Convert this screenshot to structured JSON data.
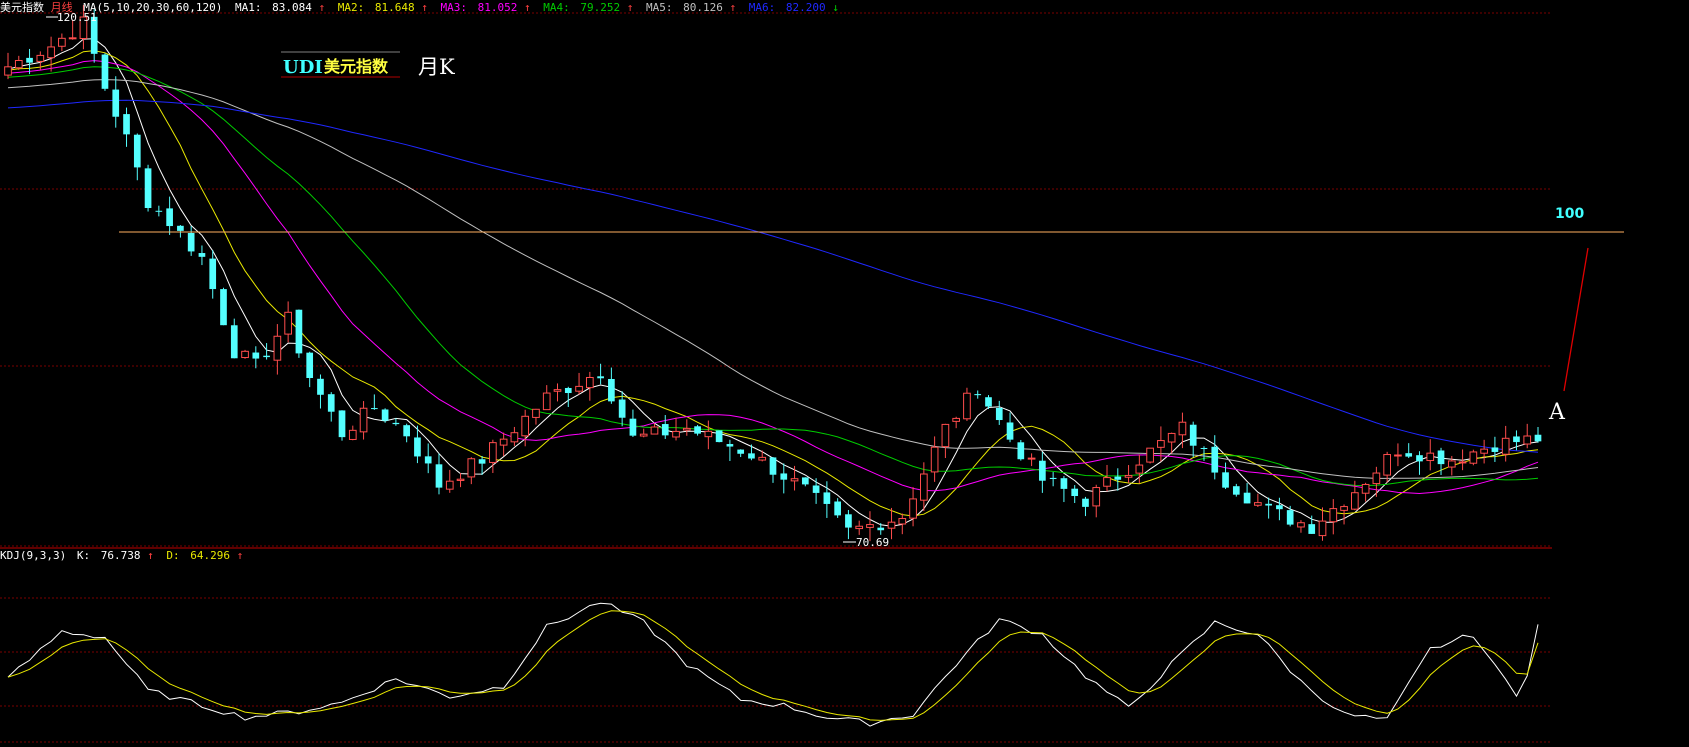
{
  "colors": {
    "up": "#ff4d4d",
    "down": "#54ffff",
    "ma1": "#ffffff",
    "ma2": "#e8e800",
    "ma3": "#ff00ff",
    "ma4": "#00cc00",
    "ma5": "#c0c0c0",
    "ma6": "#1f28ff",
    "grid": "#7a0000",
    "kline": "#ffffff",
    "dline": "#e8e800",
    "hundred": "#ffb060",
    "arrow": "#e00000"
  },
  "header": {
    "name": "美元指数",
    "period": "月线",
    "ma_params": "MA(5,10,20,30,60,120)",
    "ma": [
      {
        "label": "MA1:",
        "value": "83.084",
        "arrow": "↑",
        "color": "#ffffff"
      },
      {
        "label": "MA2:",
        "value": "81.648",
        "arrow": "↑",
        "color": "#e8e800"
      },
      {
        "label": "MA3:",
        "value": "81.052",
        "arrow": "↑",
        "color": "#ff00ff"
      },
      {
        "label": "MA4:",
        "value": "79.252",
        "arrow": "↑",
        "color": "#00cc00"
      },
      {
        "label": "MA5:",
        "value": "80.126",
        "arrow": "↑",
        "color": "#c0c0c0"
      },
      {
        "label": "MA6:",
        "value": "82.200",
        "arrow": "↓",
        "color": "#1f28ff"
      }
    ]
  },
  "legend": {
    "code": "UDI",
    "name": "美元指数",
    "period": "月K"
  },
  "annotations": {
    "high_label": "120.51",
    "low_label": "70.69",
    "level_label": "100",
    "point_label": "A"
  },
  "kdj_header": {
    "label": "KDJ(9,3,3)",
    "k_label": "K:",
    "k_value": "76.738",
    "k_arrow": "↑",
    "d_label": "D:",
    "d_value": "64.296",
    "d_arrow": "↑"
  },
  "chart_data": [
    {
      "type": "candlestick",
      "title": "美元指数 月线",
      "ylim": [
        70,
        121
      ],
      "level_line": 100,
      "anchors": [
        [
          0,
          116
        ],
        [
          4,
          118
        ],
        [
          7,
          120.2
        ],
        [
          9,
          114
        ],
        [
          11,
          109
        ],
        [
          13,
          103
        ],
        [
          15,
          101
        ],
        [
          18,
          97.5
        ],
        [
          21,
          88.5
        ],
        [
          23,
          87
        ],
        [
          26,
          91.5
        ],
        [
          28,
          86
        ],
        [
          31,
          80.5
        ],
        [
          34,
          83
        ],
        [
          37,
          80.5
        ],
        [
          40,
          75.5
        ],
        [
          44,
          78
        ],
        [
          46,
          80
        ],
        [
          50,
          84
        ],
        [
          55,
          86.5
        ],
        [
          58,
          80
        ],
        [
          63,
          81
        ],
        [
          69,
          78.5
        ],
        [
          74,
          75
        ],
        [
          78,
          71
        ],
        [
          83,
          72.5
        ],
        [
          87,
          81
        ],
        [
          90,
          85
        ],
        [
          93,
          80
        ],
        [
          96,
          76
        ],
        [
          100,
          74
        ],
        [
          105,
          78
        ],
        [
          109,
          81
        ],
        [
          113,
          76
        ],
        [
          117,
          73
        ],
        [
          121,
          71.5
        ],
        [
          125,
          75
        ],
        [
          129,
          79
        ],
        [
          134,
          78
        ],
        [
          138,
          79.5
        ],
        [
          142,
          80
        ]
      ],
      "ma_periods": [
        5,
        10,
        20,
        30,
        60,
        120
      ],
      "ma_warmup_start": 108,
      "candle_count": 143,
      "high": 120.51,
      "low": 70.69
    },
    {
      "type": "line",
      "title": "KDJ(9,3,3)",
      "ylim": [
        0,
        100
      ],
      "series": [
        {
          "name": "K",
          "final": 76.738
        },
        {
          "name": "D",
          "final": 64.296
        }
      ]
    }
  ]
}
